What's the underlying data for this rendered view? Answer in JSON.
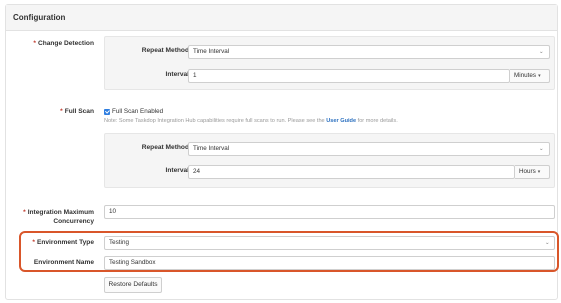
{
  "panel": {
    "title": "Configuration"
  },
  "change_detection": {
    "label": "Change Detection",
    "repeat_method_label": "Repeat Method",
    "repeat_method_value": "Time Interval",
    "interval_label": "Interval",
    "interval_value": "1",
    "interval_unit": "Minutes"
  },
  "full_scan": {
    "label": "Full Scan",
    "checkbox_label": "Full Scan Enabled",
    "checked": true,
    "note_before": "Note: Some Taskdop Integration Hub capabilities require full scans to run. Please see the",
    "note_link": "User Guide",
    "note_after": "for more details.",
    "repeat_method_label": "Repeat Method",
    "repeat_method_value": "Time Interval",
    "interval_label": "Interval",
    "interval_value": "24",
    "interval_unit": "Hours"
  },
  "concurrency": {
    "label_line1": "Integration Maximum",
    "label_line2": "Concurrency",
    "value": "10"
  },
  "environment": {
    "type_label": "Environment Type",
    "type_value": "Testing",
    "name_label": "Environment Name",
    "name_value": "Testing Sandbox"
  },
  "actions": {
    "restore_defaults": "Restore Defaults"
  },
  "colors": {
    "required": "#c0392b",
    "highlight": "#d9562a",
    "checkbox": "#2f7ee0",
    "link": "#2a6fbf"
  }
}
